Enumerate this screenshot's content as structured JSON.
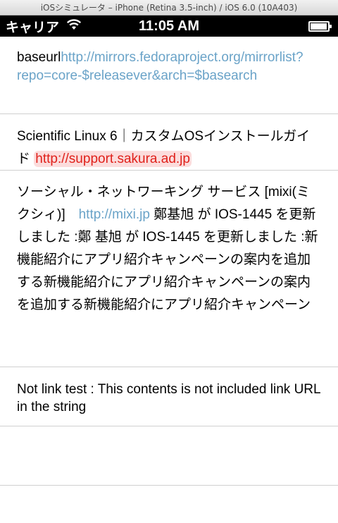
{
  "window": {
    "title": "iOSシミュレータ – iPhone (Retina 3.5-inch) / iOS 6.0 (10A403)"
  },
  "status_bar": {
    "carrier": "キャリア",
    "time": "11:05 AM",
    "battery_level": 0.95
  },
  "cells": [
    {
      "prefix": "baseurl",
      "link": "http://mirrors.fedoraproject.org/mirrorlist?repo=core-$releasever&arch=$basearch"
    },
    {
      "prefix": "Scientific Linux 6｜カスタムOSインストールガイド ",
      "link": "http://support.sakura.ad.jp"
    },
    {
      "prefix": "ソーシャル・ネットワーキング サービス [mixi(ミクシィ)]　",
      "link": "http://mixi.jp",
      "suffix": " 鄭基旭 が IOS-1445 を更新しました :鄭 基旭 が IOS-1445 を更新しました :新機能紹介にアプリ紹介キャンペーンの案内を追加する新機能紹介にアプリ紹介キャンペーンの案内を追加する新機能紹介にアプリ紹介キャンペーン"
    },
    {
      "text": "Not link test : This contents is not included link URL in the string"
    }
  ]
}
